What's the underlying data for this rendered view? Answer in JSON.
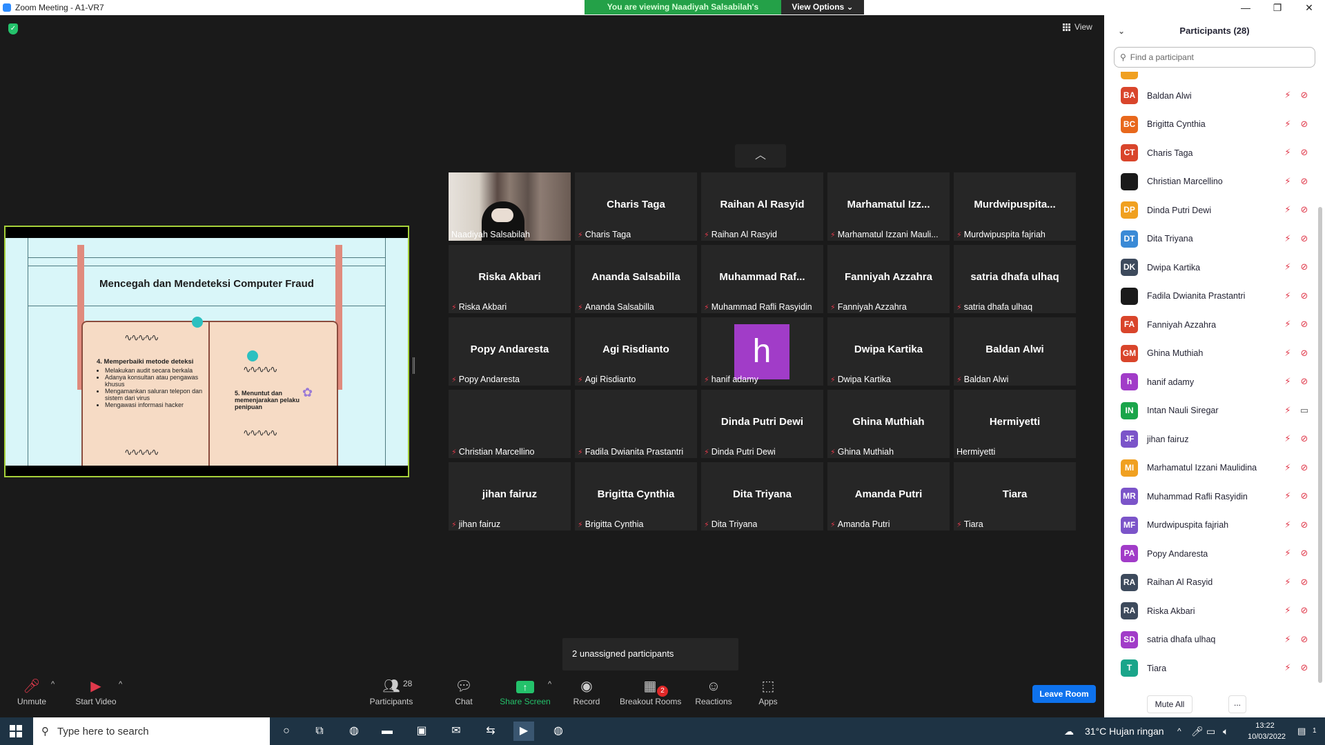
{
  "window": {
    "title": "Zoom Meeting - A1-VR7",
    "controls": [
      "—",
      "❐",
      "✕"
    ]
  },
  "banner": {
    "message": "You are viewing Naadiyah Salsabilah's screen",
    "options": "View Options ⌄"
  },
  "view_button": "View",
  "shared_slide": {
    "title": "Mencegah dan Mendeteksi Computer Fraud",
    "left_heading": "4. Memperbaiki metode deteksi",
    "left_bullets": [
      "Melakukan audit secara berkala",
      "Adanya konsultan atau pengawas khusus",
      "Mengamankan saluran telepon dan sistem dari virus",
      "Mengawasi informasi hacker"
    ],
    "right_text": "5. Menuntut dan memenjarakan pelaku penipuan"
  },
  "collapse_icon": "chevron-up-icon",
  "tiles": [
    {
      "big": "",
      "name": "Naadiyah Salsabilah",
      "muted": false,
      "camera": true
    },
    {
      "big": "Charis Taga",
      "name": "Charis Taga",
      "muted": true
    },
    {
      "big": "Raihan Al Rasyid",
      "name": "Raihan Al Rasyid",
      "muted": true
    },
    {
      "big": "Marhamatul  Izz...",
      "name": "Marhamatul Izzani Mauli...",
      "muted": true
    },
    {
      "big": "Murdwipuspita...",
      "name": "Murdwipuspita fajriah",
      "muted": true
    },
    {
      "big": "Riska Akbari",
      "name": "Riska Akbari",
      "muted": true
    },
    {
      "big": "Ananda Salsabilla",
      "name": "Ananda Salsabilla",
      "muted": true
    },
    {
      "big": "Muhammad  Raf...",
      "name": "Muhammad Rafli Rasyidin",
      "muted": true
    },
    {
      "big": "Fanniyah Azzahra",
      "name": "Fanniyah Azzahra",
      "muted": true
    },
    {
      "big": "satria dhafa ulhaq",
      "name": "satria dhafa ulhaq",
      "muted": true
    },
    {
      "big": "Popy Andaresta",
      "name": "Popy Andaresta",
      "muted": true
    },
    {
      "big": "Agi Risdianto",
      "name": "Agi Risdianto",
      "muted": true
    },
    {
      "big": "",
      "name": "hanif adamy",
      "muted": true,
      "avatar": "h"
    },
    {
      "big": "Dwipa Kartika",
      "name": "Dwipa Kartika",
      "muted": true
    },
    {
      "big": "Baldan Alwi",
      "name": "Baldan Alwi",
      "muted": true
    },
    {
      "big": "",
      "name": "Christian Marcellino",
      "muted": true
    },
    {
      "big": "",
      "name": "Fadila Dwianita Prastantri",
      "muted": true
    },
    {
      "big": "Dinda Putri Dewi",
      "name": "Dinda Putri Dewi",
      "muted": true
    },
    {
      "big": "Ghina Muthiah",
      "name": "Ghina Muthiah",
      "muted": true
    },
    {
      "big": "Hermiyetti",
      "name": "Hermiyetti",
      "muted": false
    },
    {
      "big": "jihan fairuz",
      "name": "jihan fairuz",
      "muted": true
    },
    {
      "big": "Brigitta Cynthia",
      "name": "Brigitta Cynthia",
      "muted": true
    },
    {
      "big": "Dita Triyana",
      "name": "Dita Triyana",
      "muted": true
    },
    {
      "big": "Amanda Putri",
      "name": "Amanda Putri",
      "muted": true
    },
    {
      "big": "Tiara",
      "name": "Tiara",
      "muted": true
    }
  ],
  "unassigned": "2 unassigned participants",
  "toolbar": {
    "unmute": "Unmute",
    "start_video": "Start Video",
    "participants": "Participants",
    "participants_count": "28",
    "chat": "Chat",
    "share_screen": "Share Screen",
    "record": "Record",
    "breakout_rooms": "Breakout Rooms",
    "breakout_badge": "2",
    "reactions": "Reactions",
    "apps": "Apps",
    "leave": "Leave Room"
  },
  "panel": {
    "title": "Participants (28)",
    "search_placeholder": "Find a participant",
    "mute_all": "Mute All",
    "more": "...",
    "participants": [
      {
        "initials": "BA",
        "name": "Baldan Alwi",
        "color": "#d9452b",
        "video": false
      },
      {
        "initials": "BC",
        "name": "Brigitta Cynthia",
        "color": "#e8681c",
        "video": false
      },
      {
        "initials": "CT",
        "name": "Charis Taga",
        "color": "#d9452b",
        "video": false
      },
      {
        "initials": "",
        "name": "Christian Marcellino",
        "color": "#1a1a1a",
        "video": false
      },
      {
        "initials": "DP",
        "name": "Dinda Putri Dewi",
        "color": "#f0a020",
        "video": false
      },
      {
        "initials": "DT",
        "name": "Dita Triyana",
        "color": "#3a8ad6",
        "video": false
      },
      {
        "initials": "DK",
        "name": "Dwipa Kartika",
        "color": "#3d4a5c",
        "video": false
      },
      {
        "initials": "",
        "name": "Fadila Dwianita Prastantri",
        "color": "#1a1a1a",
        "video": false
      },
      {
        "initials": "FA",
        "name": "Fanniyah Azzahra",
        "color": "#d9452b",
        "video": false
      },
      {
        "initials": "GM",
        "name": "Ghina Muthiah",
        "color": "#d9452b",
        "video": false
      },
      {
        "initials": "h",
        "name": "hanif adamy",
        "color": "#a13cc8",
        "video": false
      },
      {
        "initials": "IN",
        "name": "Intan Nauli Siregar",
        "color": "#1aa54a",
        "video": true
      },
      {
        "initials": "JF",
        "name": "jihan fairuz",
        "color": "#7b54c9",
        "video": false
      },
      {
        "initials": "MI",
        "name": "Marhamatul Izzani Maulidina",
        "color": "#f0a020",
        "video": false
      },
      {
        "initials": "MR",
        "name": "Muhammad Rafli Rasyidin",
        "color": "#7b54c9",
        "video": false
      },
      {
        "initials": "MF",
        "name": "Murdwipuspita fajriah",
        "color": "#7b54c9",
        "video": false
      },
      {
        "initials": "PA",
        "name": "Popy Andaresta",
        "color": "#a13cc8",
        "video": false
      },
      {
        "initials": "RA",
        "name": "Raihan Al Rasyid",
        "color": "#3d4a5c",
        "video": false
      },
      {
        "initials": "RA",
        "name": "Riska Akbari",
        "color": "#3d4a5c",
        "video": false
      },
      {
        "initials": "SD",
        "name": "satria dhafa ulhaq",
        "color": "#a13cc8",
        "video": false
      },
      {
        "initials": "T",
        "name": "Tiara",
        "color": "#1aa58a",
        "video": false
      }
    ]
  },
  "taskbar": {
    "search_placeholder": "Type here to search",
    "weather": "31°C  Hujan ringan",
    "time": "13:22",
    "date": "10/03/2022",
    "notification_count": "1"
  }
}
